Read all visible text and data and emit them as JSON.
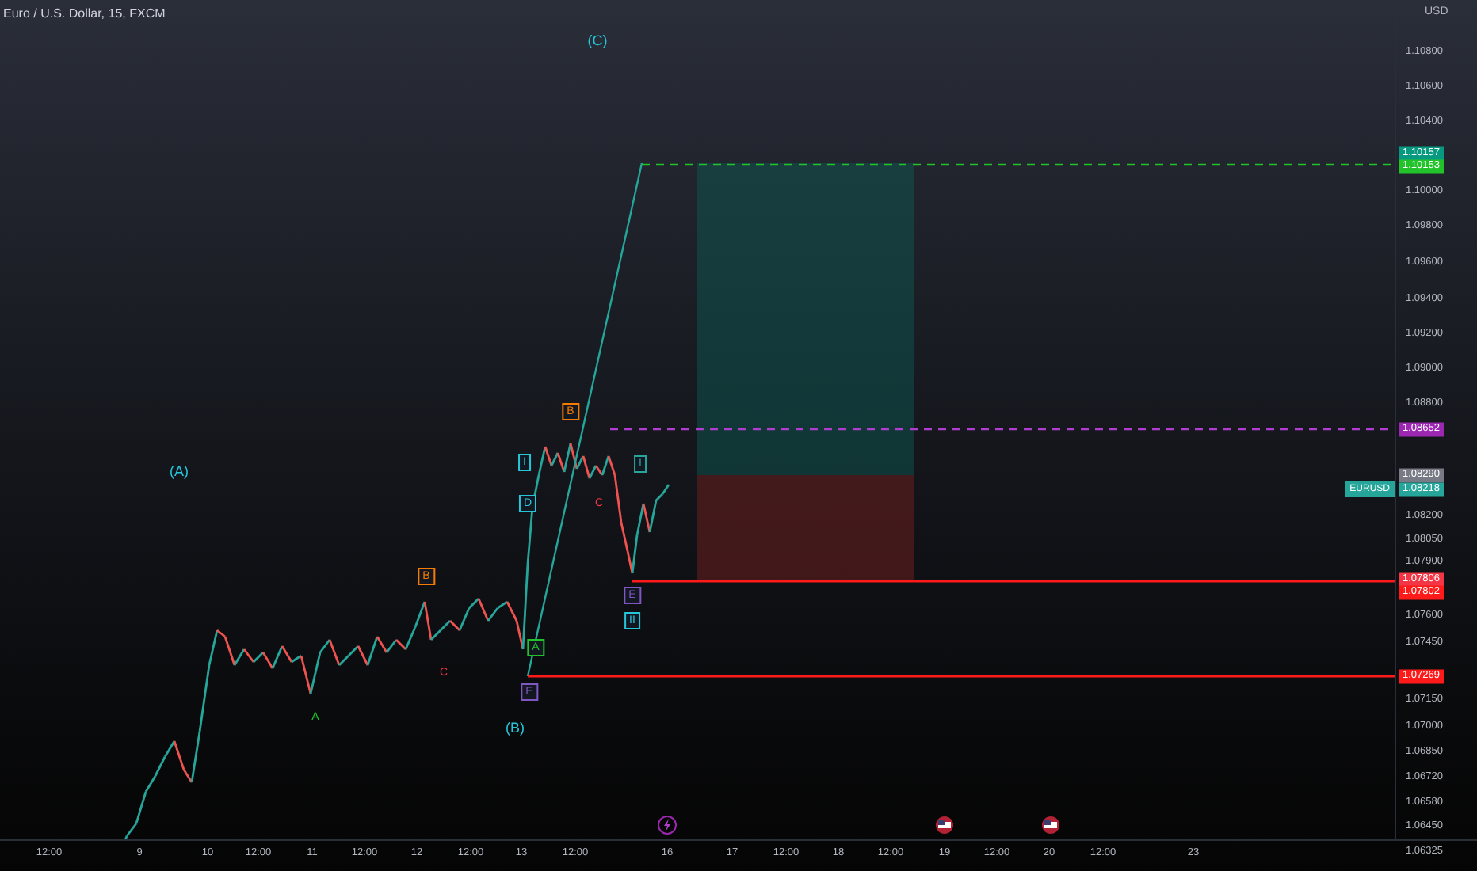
{
  "title": "Euro / U.S. Dollar, 15, FXCM",
  "price_axis": {
    "currency": "USD",
    "ticks": [
      {
        "kind": "tick",
        "text": "1.10800"
      },
      {
        "kind": "tick",
        "text": "1.10600"
      },
      {
        "kind": "tick",
        "text": "1.10400"
      },
      {
        "kind": "badge",
        "text": "1.10157",
        "color": "#089981"
      },
      {
        "kind": "badge",
        "text": "1.10153",
        "color": "#22c32a"
      },
      {
        "kind": "tick",
        "text": "1.10000"
      },
      {
        "kind": "tick",
        "text": "1.09800"
      },
      {
        "kind": "tick",
        "text": "1.09600"
      },
      {
        "kind": "tick",
        "text": "1.09400"
      },
      {
        "kind": "tick",
        "text": "1.09200"
      },
      {
        "kind": "tick",
        "text": "1.09000"
      },
      {
        "kind": "tick",
        "text": "1.08800"
      },
      {
        "kind": "badge",
        "text": "1.08652",
        "color": "#9c27b0"
      },
      {
        "kind": "badge",
        "text": "1.08290",
        "color": "#787b86"
      },
      {
        "kind": "badge",
        "text": "1.08218",
        "color": "#26a69a"
      },
      {
        "kind": "tick",
        "text": "1.08200"
      },
      {
        "kind": "tick",
        "text": "1.08050"
      },
      {
        "kind": "tick",
        "text": "1.07900"
      },
      {
        "kind": "badge",
        "text": "1.07806",
        "color": "#f23645"
      },
      {
        "kind": "badge",
        "text": "1.07802",
        "color": "#ff1a1a"
      },
      {
        "kind": "tick",
        "text": "1.07600"
      },
      {
        "kind": "tick",
        "text": "1.07450"
      },
      {
        "kind": "badge",
        "text": "1.07269",
        "color": "#ff1a1a"
      },
      {
        "kind": "tick",
        "text": "1.07150"
      },
      {
        "kind": "tick",
        "text": "1.07000"
      },
      {
        "kind": "tick",
        "text": "1.06850"
      },
      {
        "kind": "tick",
        "text": "1.06720"
      },
      {
        "kind": "tick",
        "text": "1.06580"
      },
      {
        "kind": "tick",
        "text": "1.06450"
      },
      {
        "kind": "tick",
        "text": "1.06325"
      }
    ]
  },
  "symbol_tag": "EURUSD",
  "wave_labels": [
    {
      "text": "(C)",
      "kind": "plain",
      "color": "#26c6da"
    },
    {
      "text": "(A)",
      "kind": "plain",
      "color": "#26c6da"
    },
    {
      "text": "(B)",
      "kind": "plain",
      "color": "#26c6da"
    },
    {
      "text": "A",
      "kind": "plain",
      "color": "#22c32a"
    },
    {
      "text": "B",
      "kind": "boxed",
      "color": "#f57c00"
    },
    {
      "text": "C",
      "kind": "plain",
      "color": "#f23645"
    },
    {
      "text": "A",
      "kind": "boxed",
      "color": "#22c32a"
    },
    {
      "text": "E",
      "kind": "boxed",
      "color": "#7e57c2"
    },
    {
      "text": "I",
      "kind": "boxed",
      "color": "#26c6da"
    },
    {
      "text": "D",
      "kind": "boxed",
      "color": "#26c6da"
    },
    {
      "text": "B",
      "kind": "boxed",
      "color": "#f57c00"
    },
    {
      "text": "C",
      "kind": "plain",
      "color": "#f23645"
    },
    {
      "text": "I",
      "kind": "boxed",
      "color": "#26a69a"
    },
    {
      "text": "E",
      "kind": "boxed",
      "color": "#7e57c2"
    },
    {
      "text": "II",
      "kind": "boxed",
      "color": "#26c6da"
    }
  ],
  "time_axis": {
    "ticks": [
      "12:00",
      "9",
      "10",
      "12:00",
      "11",
      "12:00",
      "12",
      "12:00",
      "13",
      "12:00",
      "16",
      "17",
      "12:00",
      "18",
      "12:00",
      "19",
      "12:00",
      "20",
      "12:00",
      "23"
    ]
  }
}
